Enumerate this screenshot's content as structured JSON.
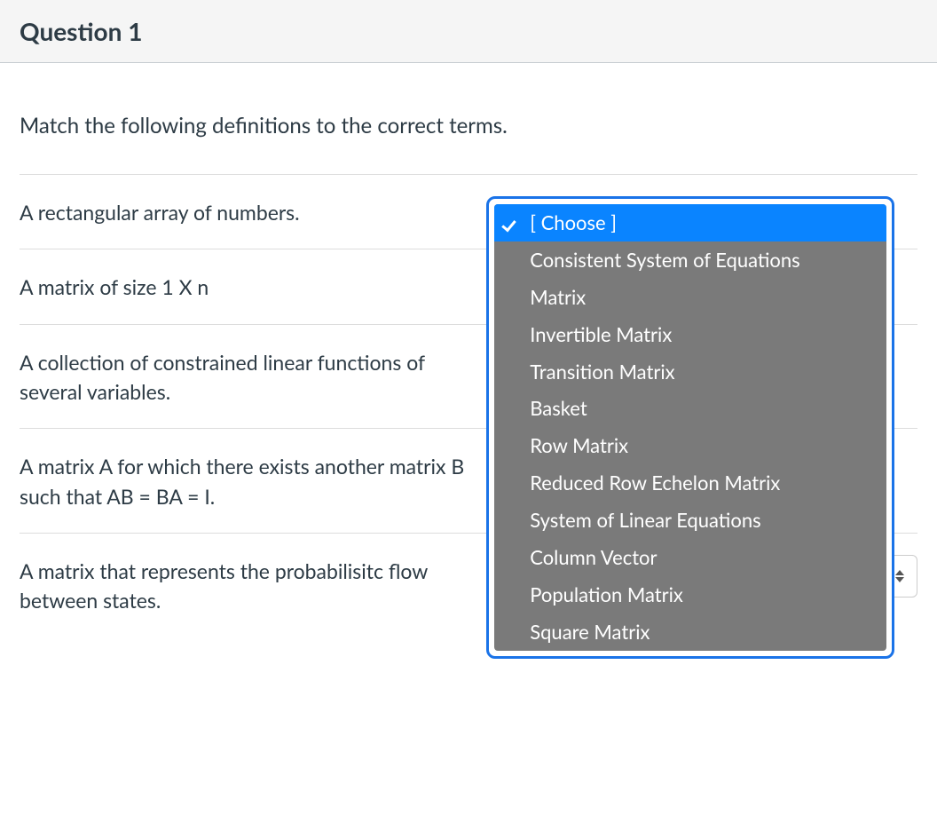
{
  "header": {
    "title": "Question 1"
  },
  "instructions": "Match the following definitions to the correct terms.",
  "choose_placeholder": "[ Choose ]",
  "rows": [
    {
      "prompt": "A rectangular array of numbers."
    },
    {
      "prompt": "A matrix of size 1 X n"
    },
    {
      "prompt": "A collection of constrained linear functions of several variables."
    },
    {
      "prompt": "A matrix A for which there exists another matrix B such that AB = BA = I."
    },
    {
      "prompt": "A matrix that represents the probabilisitc flow between states."
    }
  ],
  "dropdown": {
    "options": [
      "[ Choose ]",
      "Consistent System of Equations",
      "Matrix",
      "Invertible Matrix",
      "Transition Matrix",
      "Basket",
      "Row Matrix",
      "Reduced Row Echelon Matrix",
      "System of Linear Equations",
      "Column Vector",
      "Population Matrix",
      "Square Matrix"
    ],
    "selected_index": 0
  }
}
